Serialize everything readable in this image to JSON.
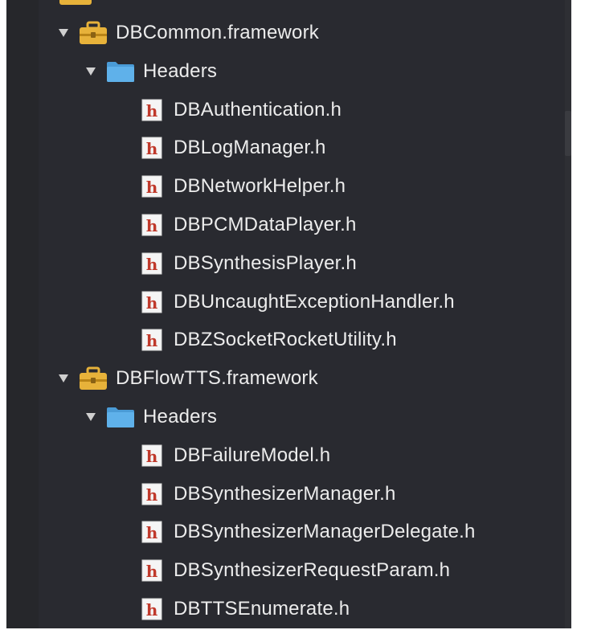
{
  "tree": [
    {
      "kind": "framework",
      "label": "DBCommon.framework",
      "expanded": true,
      "children": [
        {
          "kind": "folder",
          "label": "Headers",
          "expanded": true,
          "files": [
            "DBAuthentication.h",
            "DBLogManager.h",
            "DBNetworkHelper.h",
            "DBPCMDataPlayer.h",
            "DBSynthesisPlayer.h",
            "DBUncaughtExceptionHandler.h",
            "DBZSocketRocketUtility.h"
          ]
        }
      ]
    },
    {
      "kind": "framework",
      "label": "DBFlowTTS.framework",
      "expanded": true,
      "children": [
        {
          "kind": "folder",
          "label": "Headers",
          "expanded": true,
          "files": [
            "DBFailureModel.h",
            "DBSynthesizerManager.h",
            "DBSynthesizerManagerDelegate.h",
            "DBSynthesizerRequestParam.h",
            "DBTTSEnumerate.h"
          ]
        }
      ]
    }
  ],
  "icons": {
    "framework": "toolbox-icon",
    "folder": "folder-icon",
    "header_file": "header-file-icon",
    "disclosure": "disclosure-triangle-icon"
  },
  "colors": {
    "background": "#292a30",
    "text": "#ececec",
    "folder": "#5fb1ea",
    "toolbox": "#e7b23a",
    "header_badge_bg": "#f5f5f5",
    "header_badge_letter": "#c0392b"
  }
}
